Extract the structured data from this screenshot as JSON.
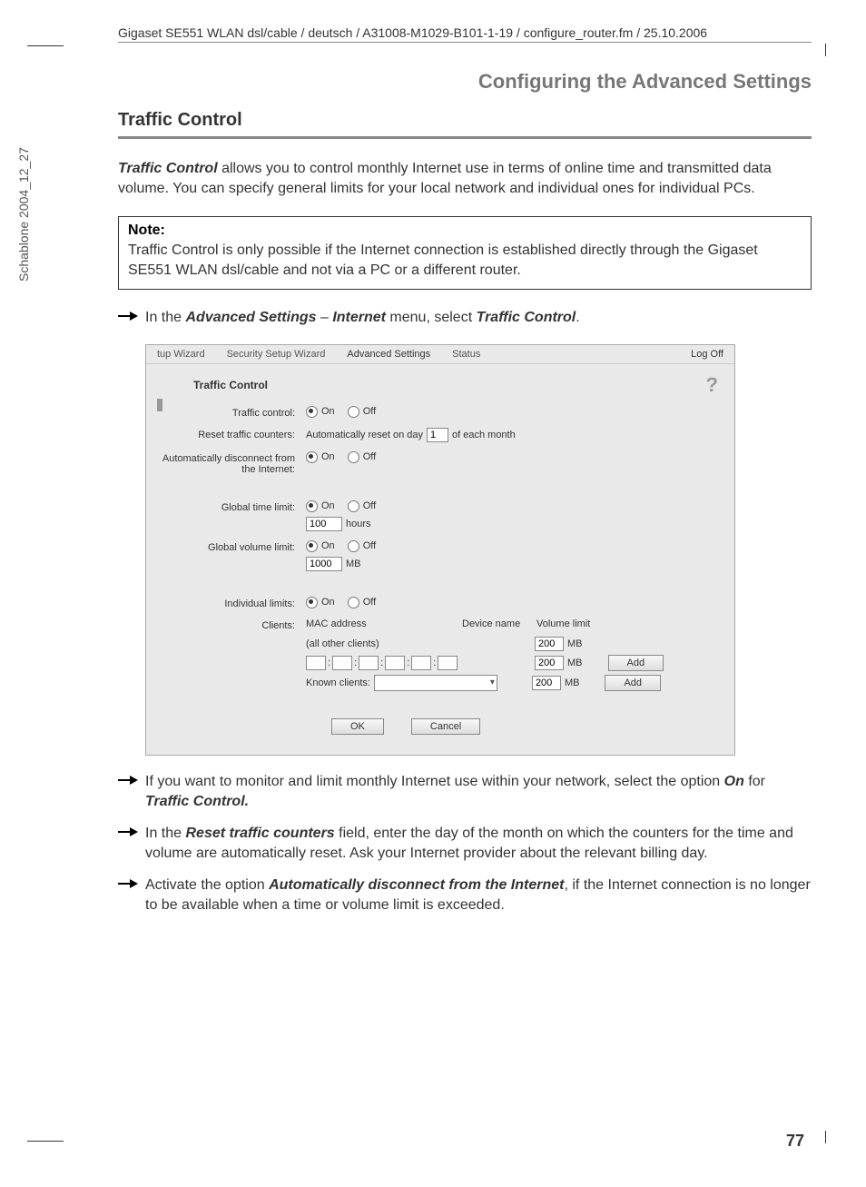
{
  "header": {
    "path": "Gigaset SE551 WLAN dsl/cable / deutsch / A31008-M1029-B101-1-19 / configure_router.fm / 25.10.2006"
  },
  "side": "Schablone 2004_12_27",
  "chapter": "Configuring the Advanced Settings",
  "section": "Traffic Control",
  "intro_bold": "Traffic Control",
  "intro_rest": " allows you to control monthly Internet use in terms of online time and transmitted data volume. You can specify general limits for your local network and individual ones for individual PCs.",
  "note": {
    "title": "Note:",
    "body": "Traffic Control is only possible if the Internet connection is established directly through the Gigaset SE551 WLAN dsl/cable and not via a PC or a different router."
  },
  "instr1": {
    "pre": "In the ",
    "b1": "Advanced Settings",
    "mid1": " – ",
    "b2": "Internet",
    "mid2": " menu, select ",
    "b3": "Traffic Control",
    "post": "."
  },
  "ss": {
    "tabs": {
      "t1": "tup Wizard",
      "t2": "Security Setup Wizard",
      "t3": "Advanced Settings",
      "t4": "Status"
    },
    "logoff": "Log Off",
    "title": "Traffic Control",
    "help": "?",
    "rows": {
      "traffic_control": "Traffic control:",
      "reset": "Reset traffic counters:",
      "reset_pre": "Automatically reset on day",
      "reset_val": "1",
      "reset_post": "of each month",
      "auto_disc": "Automatically disconnect from the Internet:",
      "gtl": "Global time limit:",
      "gtl_val": "100",
      "gtl_unit": "hours",
      "gvl": "Global volume limit:",
      "gvl_val": "1000",
      "gvl_unit": "MB",
      "ind": "Individual limits:",
      "clients": "Clients:",
      "on": "On",
      "off": "Off"
    },
    "table": {
      "h_mac": "MAC address",
      "h_dev": "Device name",
      "h_vol": "Volume limit",
      "all_other": "(all other clients)",
      "v1": "200",
      "u1": "MB",
      "v2": "200",
      "u2": "MB",
      "known": "Known clients:",
      "v3": "200",
      "u3": "MB",
      "add": "Add"
    },
    "ok": "OK",
    "cancel": "Cancel"
  },
  "instr2": {
    "pre": "If you want to monitor and limit monthly Internet use within your network, select the option ",
    "b1": "On",
    "mid": " for ",
    "b2": "Traffic Control.",
    "post": ""
  },
  "instr3": {
    "pre": "In the ",
    "b1": "Reset traffic counters",
    "post": " field, enter the day of the month on which the counters for the time and volume are automatically reset. Ask your Internet provider about the relevant billing day."
  },
  "instr4": {
    "pre": "Activate the option ",
    "b1": "Automatically disconnect from the Internet",
    "post": ", if the Internet connection is no longer to be available when a time or volume limit is exceeded."
  },
  "page_num": "77"
}
